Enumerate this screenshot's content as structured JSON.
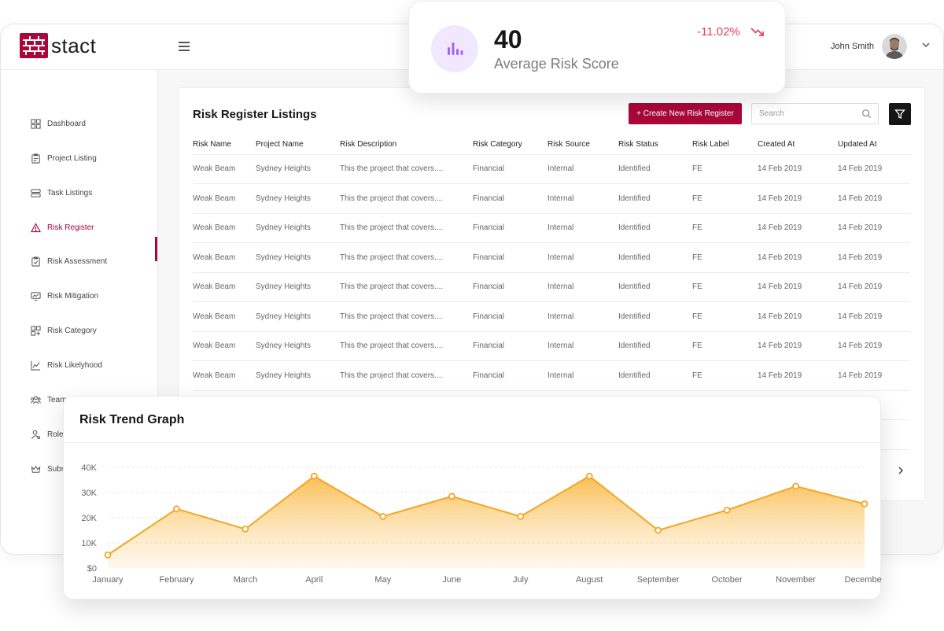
{
  "brand": {
    "name": "stact",
    "color": "#a8073a"
  },
  "header": {
    "user_name": "John Smith"
  },
  "sidebar": {
    "items": [
      {
        "label": "Dashboard",
        "icon": "dashboard-icon"
      },
      {
        "label": "Project Listing",
        "icon": "clipboard-icon"
      },
      {
        "label": "Task Listings",
        "icon": "tasks-icon"
      },
      {
        "label": "Risk Register",
        "icon": "warning-icon",
        "active": true
      },
      {
        "label": "Risk Assessment",
        "icon": "clipboard-check-icon"
      },
      {
        "label": "Risk Mitigation",
        "icon": "monitor-chart-icon"
      },
      {
        "label": "Risk Category",
        "icon": "category-icon"
      },
      {
        "label": "Risk Likelyhood",
        "icon": "line-chart-icon"
      },
      {
        "label": "Team Members",
        "icon": "team-icon"
      },
      {
        "label": "Role",
        "icon": "user-icon"
      },
      {
        "label": "Subs",
        "icon": "crown-icon"
      }
    ]
  },
  "risk_register": {
    "title": "Risk Register Listings",
    "create_label": "+ Create New Risk Register",
    "search_placeholder": "Search",
    "columns": [
      "Risk Name",
      "Project Name",
      "Risk Description",
      "Risk Category",
      "Risk Source",
      "Risk Status",
      "Risk Label",
      "Created At",
      "Updated At"
    ],
    "rows": [
      [
        "Weak Beam",
        "Sydney Heights",
        "This the project that covers....",
        "Financial",
        "Internal",
        "Identified",
        "FE",
        "14 Feb 2019",
        "14 Feb 2019"
      ],
      [
        "Weak Beam",
        "Sydney Heights",
        "This the project that covers....",
        "Financial",
        "Internal",
        "Identified",
        "FE",
        "14 Feb 2019",
        "14 Feb 2019"
      ],
      [
        "Weak Beam",
        "Sydney Heights",
        "This the project that covers....",
        "Financial",
        "Internal",
        "Identified",
        "FE",
        "14 Feb 2019",
        "14 Feb 2019"
      ],
      [
        "Weak Beam",
        "Sydney Heights",
        "This the project that covers....",
        "Financial",
        "Internal",
        "Identified",
        "FE",
        "14 Feb 2019",
        "14 Feb 2019"
      ],
      [
        "Weak Beam",
        "Sydney Heights",
        "This the project that covers....",
        "Financial",
        "Internal",
        "Identified",
        "FE",
        "14 Feb 2019",
        "14 Feb 2019"
      ],
      [
        "Weak Beam",
        "Sydney Heights",
        "This the project that covers....",
        "Financial",
        "Internal",
        "Identified",
        "FE",
        "14 Feb 2019",
        "14 Feb 2019"
      ],
      [
        "Weak Beam",
        "Sydney Heights",
        "This the project that covers....",
        "Financial",
        "Internal",
        "Identified",
        "FE",
        "14 Feb 2019",
        "14 Feb 2019"
      ],
      [
        "Weak Beam",
        "Sydney Heights",
        "This the project that covers....",
        "Financial",
        "Internal",
        "Identified",
        "FE",
        "14 Feb 2019",
        "14 Feb 2019"
      ]
    ]
  },
  "score_card": {
    "value": "40",
    "label": "Average Risk Score",
    "change": "-11.02%",
    "change_color": "#e0435b",
    "icon": "bar-chart-icon",
    "icon_color": "#a463f2"
  },
  "chart_data": {
    "type": "area",
    "title": "Risk Trend Graph",
    "x": [
      "January",
      "February",
      "March",
      "April",
      "May",
      "June",
      "July",
      "August",
      "September",
      "October",
      "November",
      "December"
    ],
    "values": [
      5200,
      23500,
      15500,
      36500,
      20500,
      28500,
      20500,
      36500,
      15000,
      23000,
      32500,
      25500
    ],
    "ylim": [
      0,
      40000
    ],
    "yticks": [
      0,
      10000,
      20000,
      30000,
      40000
    ],
    "ytick_labels": [
      "$0",
      "10K",
      "20K",
      "30K",
      "40K"
    ],
    "grid": true,
    "line_color": "#f5a623"
  }
}
